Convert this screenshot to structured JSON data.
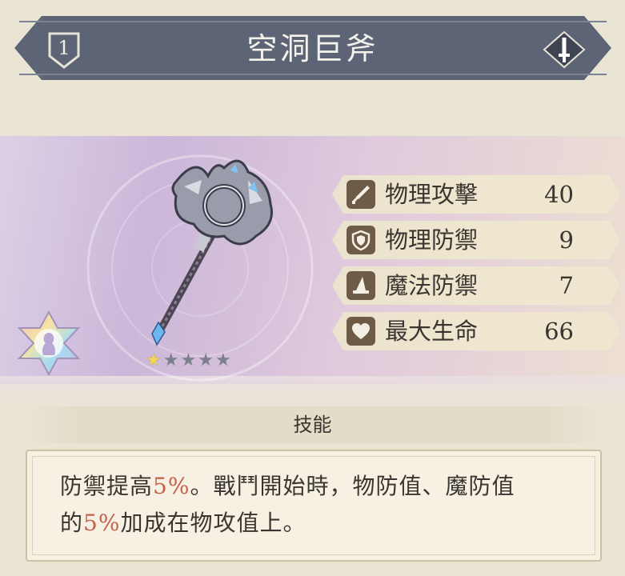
{
  "header": {
    "level": "1",
    "title": "空洞巨斧",
    "type_icon": "sword-diamond-icon"
  },
  "weapon": {
    "image": "battle-axe-illustration",
    "rarity_badge": "rainbow-rarity-emblem-icon",
    "stars": {
      "filled": 1,
      "total": 5
    }
  },
  "stats": [
    {
      "icon": "sword-icon",
      "label": "物理攻擊",
      "value": "40"
    },
    {
      "icon": "shield-icon",
      "label": "物理防禦",
      "value": "9"
    },
    {
      "icon": "wizard-hat-icon",
      "label": "魔法防禦",
      "value": "7"
    },
    {
      "icon": "heart-icon",
      "label": "最大生命",
      "value": "66"
    }
  ],
  "skill": {
    "title": "技能",
    "line1": {
      "a": "防禦提高",
      "pct": "5%",
      "b": "。戰鬥開始時，物防值、魔防值"
    },
    "line2": {
      "a": "的",
      "pct": "5%",
      "b": "加成在物攻值上。"
    }
  },
  "colors": {
    "banner": "#5d6475",
    "highlight": "#c5604a",
    "text": "#3a3530",
    "stat_icon_bg": "#6d5b45"
  }
}
